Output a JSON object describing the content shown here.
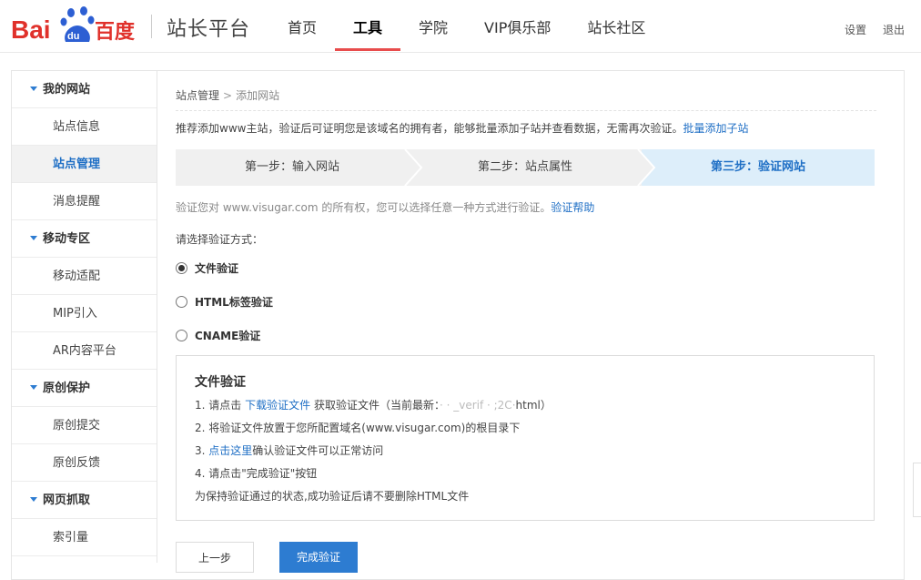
{
  "header": {
    "logo_text": "Bai du百度",
    "site_title": "站长平台",
    "nav": [
      {
        "label": "首页",
        "active": false
      },
      {
        "label": "工具",
        "active": true
      },
      {
        "label": "学院",
        "active": false
      },
      {
        "label": "VIP俱乐部",
        "active": false
      },
      {
        "label": "站长社区",
        "active": false
      }
    ],
    "settings_label": "设置",
    "logout_label": "退出"
  },
  "sidebar": {
    "groups": [
      {
        "title": "我的网站",
        "items": [
          "站点信息",
          "站点管理",
          "消息提醒"
        ]
      },
      {
        "title": "移动专区",
        "items": [
          "移动适配",
          "MIP引入",
          "AR内容平台"
        ]
      },
      {
        "title": "原创保护",
        "items": [
          "原创提交",
          "原创反馈"
        ]
      },
      {
        "title": "网页抓取",
        "items": [
          "索引量"
        ]
      }
    ],
    "active_item": "站点管理"
  },
  "breadcrumb": {
    "parent": "站点管理",
    "sep": ">",
    "current": "添加网站"
  },
  "intro": {
    "text": "推荐添加www主站，验证后可证明您是该域名的拥有者，能够批量添加子站并查看数据，无需再次验证。",
    "link": "批量添加子站"
  },
  "steps": [
    {
      "label": "第一步：输入网站",
      "active": false
    },
    {
      "label": "第二步：站点属性",
      "active": false
    },
    {
      "label": "第三步：验证网站",
      "active": true
    }
  ],
  "verify": {
    "text": "验证您对 www.visugar.com 的所有权，您可以选择任意一种方式进行验证。",
    "link": "验证帮助"
  },
  "choose_label": "请选择验证方式：",
  "methods": [
    {
      "label": "文件验证",
      "checked": true
    },
    {
      "label": "HTML标签验证",
      "checked": false
    },
    {
      "label": "CNAME验证",
      "checked": false
    }
  ],
  "panel": {
    "title": "文件验证",
    "line1_prefix": "1. 请点击",
    "line1_link": "下载验证文件",
    "line1_suffix": "获取验证文件（当前最新：",
    "line1_blur": "·  ·  _verif  ·  ;2C·",
    "line1_end": "html）",
    "line2": "2. 将验证文件放置于您所配置域名(www.visugar.com)的根目录下",
    "line3_prefix": "3.",
    "line3_link": "点击这里",
    "line3_suffix": "确认验证文件可以正常访问",
    "line4": "4. 请点击\"完成验证\"按钮",
    "note": "为保持验证通过的状态,成功验证后请不要删除HTML文件"
  },
  "buttons": {
    "prev": "上一步",
    "done": "完成验证"
  },
  "colors": {
    "accent": "#2d7cd1",
    "nav_underline": "#e84c4c",
    "link": "#1f6fc5",
    "active_step_bg": "#ddeefa"
  }
}
